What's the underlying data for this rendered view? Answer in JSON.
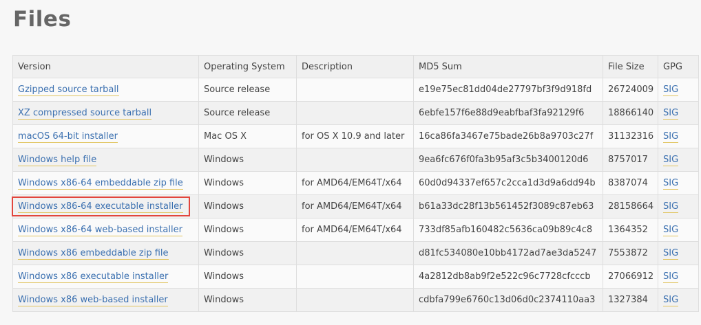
{
  "page": {
    "title": "Files"
  },
  "table": {
    "headers": [
      "Version",
      "Operating System",
      "Description",
      "MD5 Sum",
      "File Size",
      "GPG"
    ],
    "rows": [
      {
        "version": "Gzipped source tarball",
        "os": "Source release",
        "description": "",
        "md5": "e19e75ec81dd04de27797bf3f9d918fd",
        "size": "26724009",
        "gpg": "SIG"
      },
      {
        "version": "XZ compressed source tarball",
        "os": "Source release",
        "description": "",
        "md5": "6ebfe157f6e88d9eabfbaf3fa92129f6",
        "size": "18866140",
        "gpg": "SIG"
      },
      {
        "version": "macOS 64-bit installer",
        "os": "Mac OS X",
        "description": "for OS X 10.9 and later",
        "md5": "16ca86fa3467e75bade26b8a9703c27f",
        "size": "31132316",
        "gpg": "SIG"
      },
      {
        "version": "Windows help file",
        "os": "Windows",
        "description": "",
        "md5": "9ea6fc676f0fa3b95af3c5b3400120d6",
        "size": "8757017",
        "gpg": "SIG"
      },
      {
        "version": "Windows x86-64 embeddable zip file",
        "os": "Windows",
        "description": "for AMD64/EM64T/x64",
        "md5": "60d0d94337ef657c2cca1d3d9a6dd94b",
        "size": "8387074",
        "gpg": "SIG"
      },
      {
        "version": "Windows x86-64 executable installer",
        "os": "Windows",
        "description": "for AMD64/EM64T/x64",
        "md5": "b61a33dc28f13b561452f3089c87eb63",
        "size": "28158664",
        "gpg": "SIG"
      },
      {
        "version": "Windows x86-64 web-based installer",
        "os": "Windows",
        "description": "for AMD64/EM64T/x64",
        "md5": "733df85afb160482c5636ca09b89c4c8",
        "size": "1364352",
        "gpg": "SIG"
      },
      {
        "version": "Windows x86 embeddable zip file",
        "os": "Windows",
        "description": "",
        "md5": "d81fc534080e10bb4172ad7ae3da5247",
        "size": "7553872",
        "gpg": "SIG"
      },
      {
        "version": "Windows x86 executable installer",
        "os": "Windows",
        "description": "",
        "md5": "4a2812db8ab9f2e522c96c7728cfcccb",
        "size": "27066912",
        "gpg": "SIG"
      },
      {
        "version": "Windows x86 web-based installer",
        "os": "Windows",
        "description": "",
        "md5": "cdbfa799e6760c13d06d0c2374110aa3",
        "size": "1327384",
        "gpg": "SIG"
      }
    ]
  },
  "highlight": {
    "color": "#e2453c"
  },
  "colors": {
    "link": "#3b70b0",
    "link_underline": "#e0c35b",
    "title": "#666666"
  }
}
